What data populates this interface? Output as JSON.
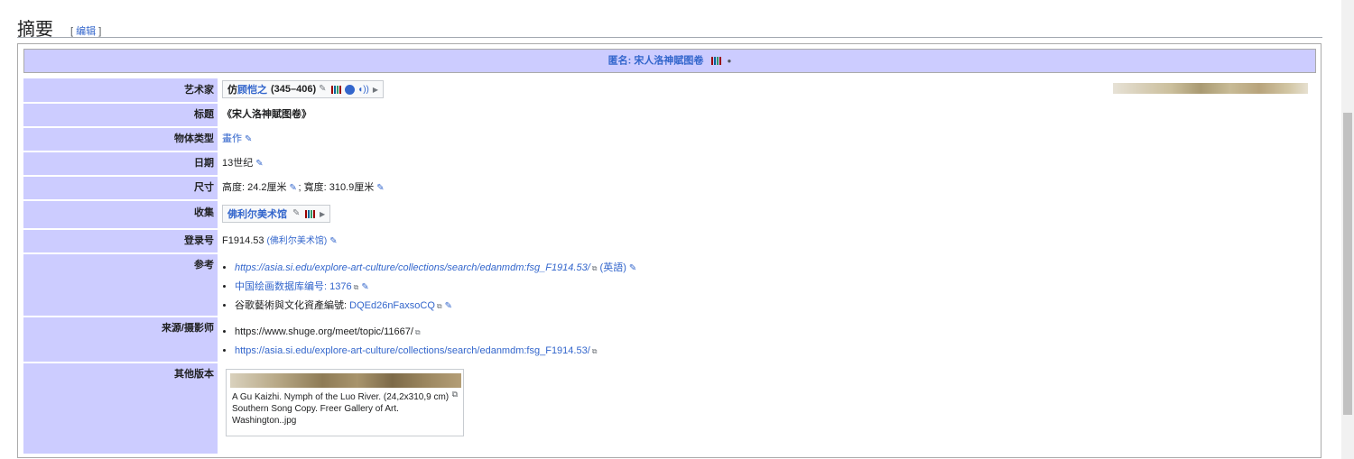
{
  "heading": {
    "title": "摘要",
    "edit_open": "[",
    "edit_label": "编辑",
    "edit_close": "]"
  },
  "infobox": {
    "title": "匿名: 宋人洛神賦图卷",
    "rows": {
      "artist": {
        "label": "艺术家",
        "prefix": "仿",
        "name": "顾恺之",
        "dates": "(345–406)"
      },
      "title": {
        "label": "标题",
        "value": "《宋人洛神賦图卷》"
      },
      "object_type": {
        "label": "物体类型",
        "value": "畫作"
      },
      "date": {
        "label": "日期",
        "value": "13世纪"
      },
      "dimensions": {
        "label": "尺寸",
        "value": "高度: 24.2厘米",
        "sep": "; 寬度: 310.9厘米"
      },
      "collection": {
        "label": "收集",
        "value": "佛利尔美术馆"
      },
      "accession": {
        "label": "登录号",
        "value": "F1914.53",
        "note": "(佛利尔美术馆)"
      },
      "references": {
        "label": "参考",
        "items": [
          {
            "link": "https://asia.si.edu/explore-art-culture/collections/search/edanmdm:fsg_F1914.53/",
            "suffix": "(英語)"
          },
          {
            "link": "中国绘画数据库编号: 1376",
            "suffix": ""
          },
          {
            "prefix": "谷歌藝術與文化資產編號: ",
            "link": "DQEd26nFaxsoCQ",
            "suffix": ""
          }
        ]
      },
      "source": {
        "label": "来源/摄影师",
        "items": [
          {
            "text": "https://www.shuge.org/meet/topic/11667/"
          },
          {
            "link": "https://asia.si.edu/explore-art-culture/collections/search/edanmdm:fsg_F1914.53/"
          }
        ]
      },
      "other_versions": {
        "label": "其他版本",
        "caption": "A Gu Kaizhi. Nymph of the Luo River. (24,2x310,9 cm) Southern Song Copy. Freer Gallery of Art. Washington..jpg"
      }
    }
  },
  "colors": {
    "header_bg": "#ccccff",
    "link": "#3366cc"
  },
  "icons": [
    "pencil-icon",
    "barcode-icon",
    "wikipedia-icon",
    "audio-icon",
    "expand-arrow-icon",
    "external-link-icon",
    "enlarge-icon"
  ]
}
